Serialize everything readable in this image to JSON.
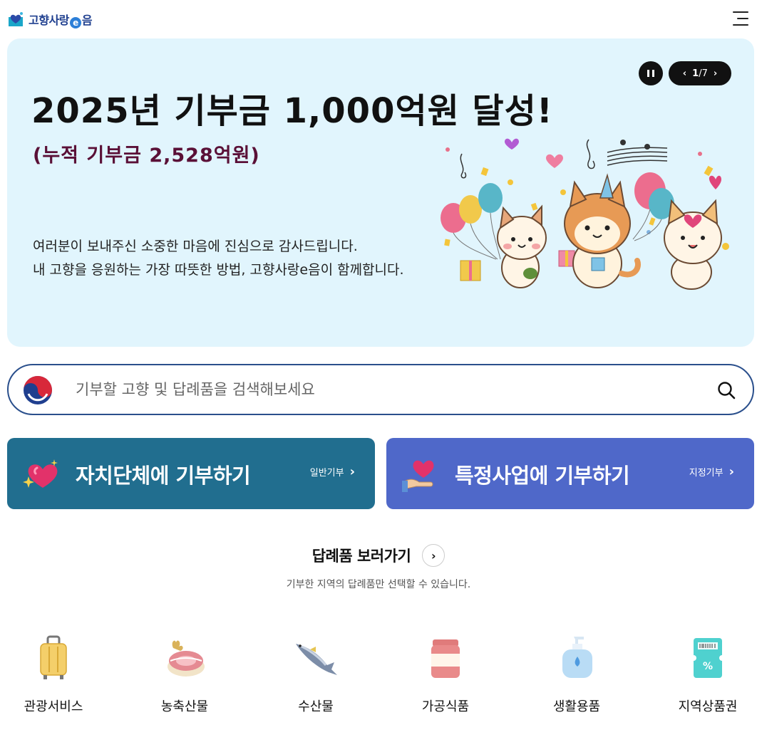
{
  "header": {
    "logo_text": "고향사랑",
    "logo_e": "e",
    "logo_tail": "음",
    "menu_icon": "hamburger-menu-icon"
  },
  "banner": {
    "title": "2025년 기부금 1,000억원 달성!",
    "subtitle": "(누적 기부금 2,528억원)",
    "desc_line1": "여러분이 보내주신 소중한 마음에 진심으로 감사드립니다.",
    "desc_line2": "내 고향을 응원하는 가장 따뜻한 방법, 고향사랑e음이 함께합니다.",
    "slide_current": "1",
    "slide_total": "/7",
    "prev_icon": "chevron-left-icon",
    "next_icon": "chevron-right-icon",
    "pause_icon": "pause-icon",
    "background": "#e1f5fd",
    "subtitle_color": "#5a1037"
  },
  "search": {
    "placeholder": "기부할 고향 및 답례품을 검색해보세요",
    "value": "",
    "border_color": "#2a4f8c"
  },
  "donate": {
    "local": {
      "title": "자치단체에 기부하기",
      "sub": "일반기부",
      "icon": "sparkling-heart-icon",
      "color": "#216e8f"
    },
    "project": {
      "title": "특정사업에 기부하기",
      "sub": "지정기부",
      "icon": "heart-on-hand-icon",
      "color": "#4f68c9"
    }
  },
  "gifts": {
    "title": "답례품 보러가기",
    "description": "기부한 지역의 답례품만 선택할 수 있습니다.",
    "categories": [
      {
        "label": "관광서비스",
        "icon": "suitcase-icon"
      },
      {
        "label": "농축산물",
        "icon": "meat-and-grain-icon"
      },
      {
        "label": "수산물",
        "icon": "fish-icon"
      },
      {
        "label": "가공식품",
        "icon": "jar-icon"
      },
      {
        "label": "생활용품",
        "icon": "soap-bottle-icon"
      },
      {
        "label": "지역상품권",
        "icon": "voucher-icon"
      }
    ]
  }
}
